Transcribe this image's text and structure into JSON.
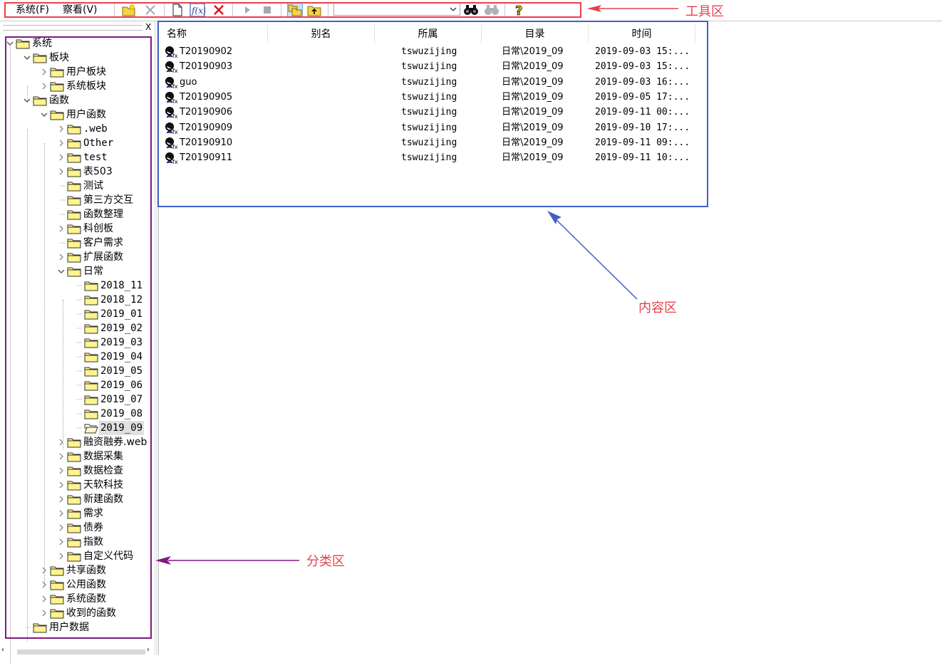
{
  "menu": {
    "system": "系统(F)",
    "view": "察看(V)"
  },
  "toolbar": {
    "buttons": [
      {
        "icon": "new-folder-icon"
      },
      {
        "icon": "delete-x-gray-icon"
      },
      {
        "icon": "new-document-icon"
      },
      {
        "icon": "function-icon"
      },
      {
        "icon": "delete-x-red-icon"
      },
      {
        "icon": "play-icon"
      },
      {
        "icon": "stop-icon"
      },
      {
        "icon": "folders-icon"
      },
      {
        "icon": "folder-up-icon"
      },
      {
        "icon": "binoculars-icon"
      },
      {
        "icon": "binoculars-gray-icon"
      },
      {
        "icon": "help-icon"
      }
    ],
    "combo_value": ""
  },
  "annotations": {
    "toolbar": "工具区",
    "content": "内容区",
    "category": "分类区",
    "colors": {
      "red": "#e8404a",
      "blue": "#4060c8",
      "purple": "#801880"
    }
  },
  "left_panel": {
    "close_label": "X"
  },
  "tree": [
    {
      "label": "系统"
    },
    {
      "label": "板块"
    },
    {
      "label": "用户板块"
    },
    {
      "label": "系统板块"
    },
    {
      "label": "函数"
    },
    {
      "label": "用户函数"
    },
    {
      "label": ".web"
    },
    {
      "label": "Other"
    },
    {
      "label": "test"
    },
    {
      "label": "表503"
    },
    {
      "label": "测试"
    },
    {
      "label": "第三方交互"
    },
    {
      "label": "函数整理"
    },
    {
      "label": "科创板"
    },
    {
      "label": "客户需求"
    },
    {
      "label": "扩展函数"
    },
    {
      "label": "日常"
    },
    {
      "label": "2018_11"
    },
    {
      "label": "2018_12"
    },
    {
      "label": "2019_01"
    },
    {
      "label": "2019_02"
    },
    {
      "label": "2019_03"
    },
    {
      "label": "2019_04"
    },
    {
      "label": "2019_05"
    },
    {
      "label": "2019_06"
    },
    {
      "label": "2019_07"
    },
    {
      "label": "2019_08"
    },
    {
      "label": "2019_09"
    },
    {
      "label": "融资融券.web"
    },
    {
      "label": "数据采集"
    },
    {
      "label": "数据检查"
    },
    {
      "label": "天软科技"
    },
    {
      "label": "新建函数"
    },
    {
      "label": "需求"
    },
    {
      "label": "债券"
    },
    {
      "label": "指数"
    },
    {
      "label": "自定义代码"
    },
    {
      "label": "共享函数"
    },
    {
      "label": "公用函数"
    },
    {
      "label": "系统函数"
    },
    {
      "label": "收到的函数"
    },
    {
      "label": "用户数据"
    }
  ],
  "list": {
    "columns": [
      "名称",
      "别名",
      "所属",
      "目录",
      "时间"
    ],
    "rows": [
      {
        "name": "T20190902",
        "alias": "",
        "owner": "tswuzijing",
        "dir": "日常\\2019_09",
        "time": "2019-09-03 15:..."
      },
      {
        "name": "T20190903",
        "alias": "",
        "owner": "tswuzijing",
        "dir": "日常\\2019_09",
        "time": "2019-09-03 15:..."
      },
      {
        "name": "guo",
        "alias": "",
        "owner": "tswuzijing",
        "dir": "日常\\2019_09",
        "time": "2019-09-03 16:..."
      },
      {
        "name": "T20190905",
        "alias": "",
        "owner": "tswuzijing",
        "dir": "日常\\2019_09",
        "time": "2019-09-05 17:..."
      },
      {
        "name": "T20190906",
        "alias": "",
        "owner": "tswuzijing",
        "dir": "日常\\2019_09",
        "time": "2019-09-11 00:..."
      },
      {
        "name": "T20190909",
        "alias": "",
        "owner": "tswuzijing",
        "dir": "日常\\2019_09",
        "time": "2019-09-10 17:..."
      },
      {
        "name": "T20190910",
        "alias": "",
        "owner": "tswuzijing",
        "dir": "日常\\2019_09",
        "time": "2019-09-11 09:..."
      },
      {
        "name": "T20190911",
        "alias": "",
        "owner": "tswuzijing",
        "dir": "日常\\2019_09",
        "time": "2019-09-11 10:..."
      }
    ]
  }
}
